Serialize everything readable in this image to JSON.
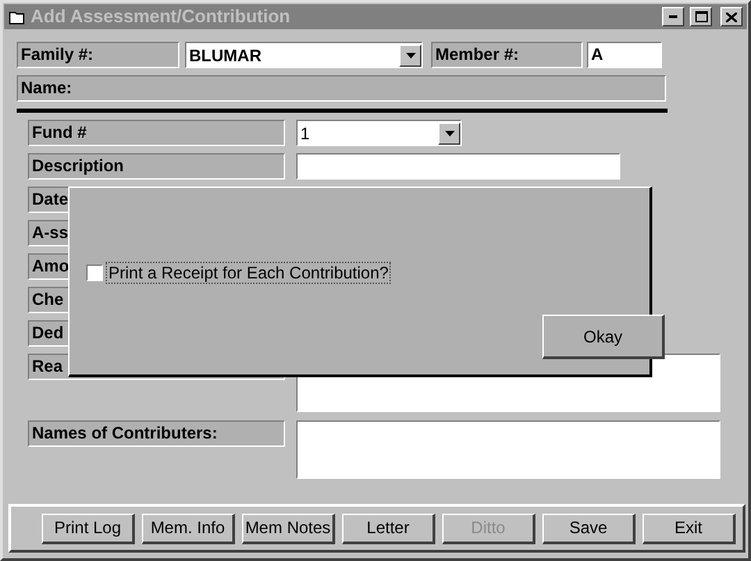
{
  "window": {
    "title": "Add Assessment/Contribution"
  },
  "family": {
    "label": "Family #:",
    "value": "BLUMAR"
  },
  "member": {
    "label": "Member #:",
    "value": "A"
  },
  "name": {
    "label": "Name:"
  },
  "fields": [
    {
      "kind": "combo",
      "label": "Fund #",
      "value": "1"
    },
    {
      "kind": "text",
      "label": "Description"
    },
    {
      "kind": "hidden",
      "label": "Date"
    },
    {
      "kind": "hidden",
      "label": "A-ss"
    },
    {
      "kind": "hidden",
      "label": "Amo"
    },
    {
      "kind": "hidden",
      "label": "Che"
    },
    {
      "kind": "hidden",
      "label": "Ded"
    },
    {
      "kind": "memo",
      "label": "Rea"
    },
    {
      "kind": "memo",
      "label": "Names of Contributers:"
    }
  ],
  "dialog": {
    "checkbox": {
      "label": "Print a Receipt for Each Contribution?",
      "checked": false
    },
    "button": "Okay"
  },
  "buttons": [
    {
      "label": "Print Log",
      "disabled": false
    },
    {
      "label": "Mem. Info",
      "disabled": false
    },
    {
      "label": "Mem Notes",
      "disabled": false
    },
    {
      "label": "Letter",
      "disabled": false
    },
    {
      "label": "Ditto",
      "disabled": true
    },
    {
      "label": "Save",
      "disabled": false
    },
    {
      "label": "Exit",
      "disabled": false
    }
  ]
}
